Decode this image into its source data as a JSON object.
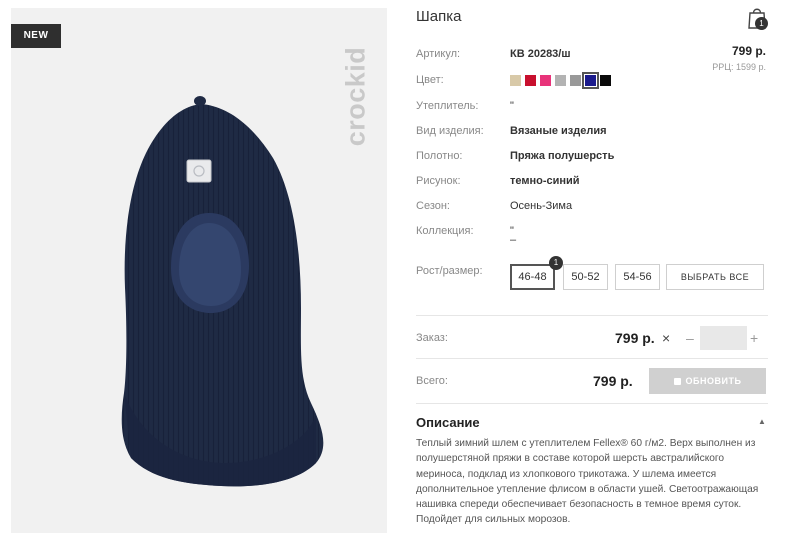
{
  "image": {
    "badge": "NEW",
    "brand_logo": "crockid"
  },
  "product": {
    "title": "Шапка",
    "price": "799 р.",
    "rrp": "РРЦ: 1599 р."
  },
  "cart": {
    "icon": "shopping-bag-icon",
    "count": "1"
  },
  "details": {
    "article_label": "Артикул:",
    "article_value": "КВ 20283/ш",
    "color_label": "Цвет:",
    "insulation_label": "Утеплитель:",
    "insulation_value": "\"",
    "type_label": "Вид изделия:",
    "type_value": "Вязаные изделия",
    "fabric_label": "Полотно:",
    "fabric_value": "Пряжа полушерсть",
    "pattern_label": "Рисунок:",
    "pattern_value": "темно-синий",
    "season_label": "Сезон:",
    "season_value": "Осень-Зима",
    "collection_label": "Коллекция:",
    "collection_value": "\"",
    "collection_value2": "–"
  },
  "colors": {
    "swatches": [
      "#d8c9a8",
      "#c8102e",
      "#e8337a",
      "#b3b3b3",
      "#999999",
      "#1a1a8c",
      "#0a0a0a"
    ],
    "selected_index": 5
  },
  "sizes": {
    "label": "Рост/размер:",
    "options": [
      "46-48",
      "50-52",
      "54-56"
    ],
    "selected_badge": "1",
    "select_all": "ВЫБРАТЬ ВСЕ"
  },
  "order": {
    "label": "Заказ:",
    "price": "799 р.",
    "multiply": "×",
    "minus": "–",
    "plus": "+",
    "quantity": ""
  },
  "total": {
    "label": "Всего:",
    "price": "799 р.",
    "update_button": "ОБНОВИТЬ"
  },
  "description": {
    "title": "Описание",
    "toggle": "▲",
    "text": "Теплый зимний шлем с утеплителем Fellex® 60 г/м2. Верх выполнен из полушерстяной пряжи в составе которой шерсть австралийского мериноса, подклад из хлопкового трикотажа. У шлема имеется дополнительное утепление флисом в области ушей. Светоотражающая нашивка спереди обеспечивает безопасность в темное время суток. Подойдет для сильных морозов."
  }
}
